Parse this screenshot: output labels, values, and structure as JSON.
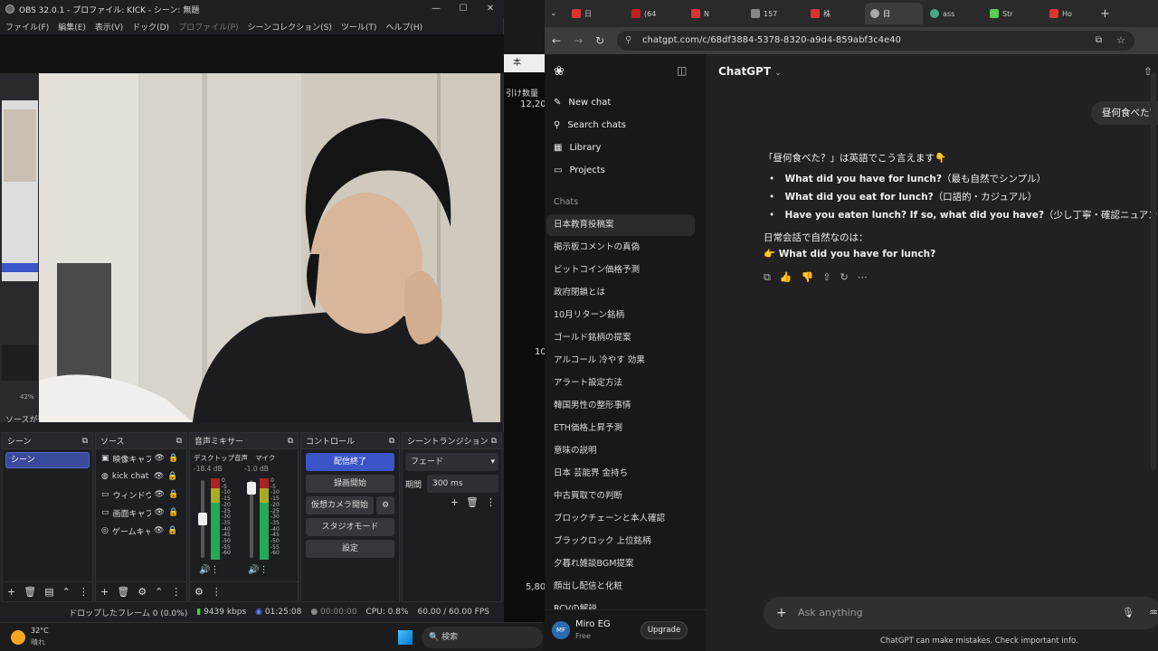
{
  "obs": {
    "title": "OBS 32.0.1 - プロファイル: KICK - シーン: 無題",
    "menu": [
      "ファイル(F)",
      "編集(E)",
      "表示(V)",
      "ドック(D)",
      "プロファイル(P)",
      "シーンコレクション(S)",
      "ツール(T)",
      "ヘルプ(H)"
    ],
    "disabled_menu": "プロファイル(P)",
    "left_labels": {
      "zoom": "42%",
      "source_hint": "ソースが選"
    },
    "panels": {
      "scenes": {
        "title": "シーン",
        "items": [
          "シーン"
        ]
      },
      "sources": {
        "title": "ソース",
        "items": [
          "映像キャプ",
          "kick chat",
          "ウィンドウキ",
          "画面キャプ",
          "ゲームキャプ"
        ]
      },
      "mixer": {
        "title": "音声ミキサー",
        "channels": [
          {
            "name": "デスクトップ音声",
            "db": "-18.4 dB"
          },
          {
            "name": "マイク",
            "db": "-1.0 dB"
          }
        ],
        "scale": [
          "0",
          "-5",
          "-10",
          "-15",
          "-20",
          "-25",
          "-30",
          "-35",
          "-40",
          "-45",
          "-50",
          "-55",
          "-60"
        ]
      },
      "controls": {
        "title": "コントロール",
        "buttons": [
          "配信終了",
          "録画開始",
          "仮想カメラ開始",
          "スタジオモード",
          "設定"
        ]
      },
      "transitions": {
        "title": "シーントランジション",
        "select": "フェード",
        "duration_label": "期間",
        "duration": "300 ms"
      }
    },
    "status": {
      "dropped": "ドロップしたフレーム 0 (0.0%)",
      "bitrate": "9439 kbps",
      "stream_time": "01:25:08",
      "rec_time": "00:00:00",
      "cpu": "CPU: 0.8%",
      "fps": "60.00 / 60.00 FPS"
    }
  },
  "middle": {
    "header": "引け数量",
    "tab_label": "本",
    "values": [
      "12,20",
      "10",
      "5,80"
    ]
  },
  "taskbar": {
    "temp": "32°C",
    "weather": "晴れ",
    "search": "検索"
  },
  "chrome": {
    "tabs": [
      {
        "label": "日",
        "color": "#d33"
      },
      {
        "label": "(64",
        "color": "#b22"
      },
      {
        "label": "N",
        "color": "#d33"
      },
      {
        "label": "157",
        "color": "#888"
      },
      {
        "label": "株",
        "color": "#d33"
      },
      {
        "label": "日",
        "color": "#aaa"
      },
      {
        "label": "ass",
        "color": "#4a8"
      },
      {
        "label": "Str",
        "color": "#5c5"
      },
      {
        "label": "Ho",
        "color": "#d33"
      }
    ],
    "url": "chatgpt.com/c/68df3884-5378-8320-a9d4-859abf3c4e40"
  },
  "chatgpt": {
    "sidebar": {
      "nav": [
        "New chat",
        "Search chats",
        "Library",
        "Projects"
      ],
      "chats_header": "Chats",
      "chats": [
        "日本教育投稿案",
        "掲示板コメントの真偽",
        "ビットコイン価格予測",
        "政府閉鎖とは",
        "10月リターン銘柄",
        "ゴールド銘柄の提案",
        "アルコール 冷やす 効果",
        "アラート設定方法",
        "韓国男性の整形事情",
        "ETH価格上昇予測",
        "意味の説明",
        "日本 芸能界 金持ち",
        "中古買取での判断",
        "ブロックチェーンと本人確認",
        "ブラックロック 上位銘柄",
        "夕暮れ雑談BGM提案",
        "顔出し配信と化粧",
        "RCVの解説"
      ],
      "user": {
        "initials": "MF",
        "name": "Miro EG",
        "plan": "Free",
        "upgrade": "Upgrade"
      }
    },
    "header": {
      "model": "ChatGPT"
    },
    "user_message": "昼何食べた？",
    "reply": {
      "intro": "「昼何食べた？」は英語でこう言えます👇",
      "bullets": [
        {
          "en": "What did you have for lunch?",
          "note": "（最も自然でシンプル）"
        },
        {
          "en": "What did you eat for lunch?",
          "note": "（口語的・カジュアル）"
        },
        {
          "en": "Have you eaten lunch? If so, what did you have?",
          "note": "（少し丁寧・確認ニュアンス）"
        }
      ],
      "natural_label": "日常会話で自然なのは：",
      "natural": "👉 What did you have for lunch?"
    },
    "input_placeholder": "Ask anything",
    "disclaimer": "ChatGPT can make mistakes. Check important info."
  }
}
